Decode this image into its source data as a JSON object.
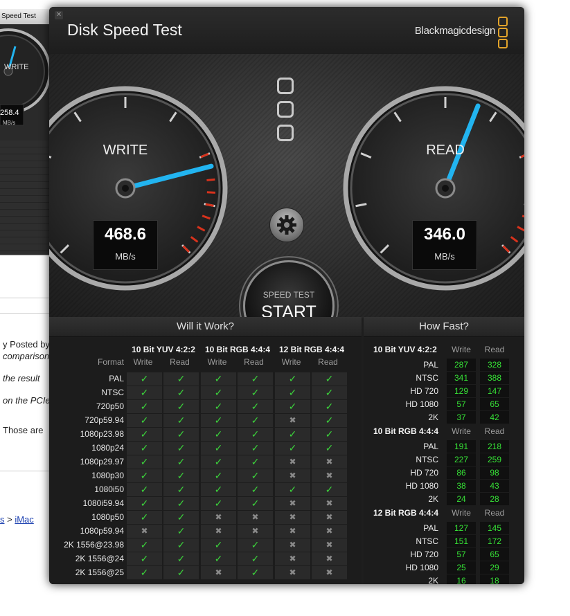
{
  "background_page": {
    "mini_window_title": "Speed Test",
    "mini_gauge_label": "WRITE",
    "mini_gauge_value": "258.4",
    "mini_gauge_unit": "MB/s",
    "text_lines": [
      "y Posted by",
      "comparison",
      "the result",
      "on the PCIe",
      "Those are"
    ],
    "breadcrumb_tail": "s",
    "breadcrumb_sep": ">",
    "breadcrumb_link": "iMac"
  },
  "window": {
    "title": "Disk Speed Test",
    "brand": "Blackmagicdesign"
  },
  "gauges": {
    "write": {
      "label": "WRITE",
      "value": "468.6",
      "unit": "MB/s",
      "needle_fraction": 0.78
    },
    "read": {
      "label": "READ",
      "value": "346.0",
      "unit": "MB/s",
      "needle_fraction": 0.58
    }
  },
  "start_button": {
    "line1": "SPEED TEST",
    "line2": "START"
  },
  "will_it_work": {
    "title": "Will it Work?",
    "format_header": "Format",
    "groups": [
      "10 Bit YUV 4:2:2",
      "10 Bit RGB 4:4:4",
      "12 Bit RGB 4:4:4"
    ],
    "subheaders": [
      "Write",
      "Read",
      "Write",
      "Read",
      "Write",
      "Read"
    ],
    "rows": [
      {
        "format": "PAL",
        "cells": [
          "y",
          "y",
          "y",
          "y",
          "y",
          "y"
        ]
      },
      {
        "format": "NTSC",
        "cells": [
          "y",
          "y",
          "y",
          "y",
          "y",
          "y"
        ]
      },
      {
        "format": "720p50",
        "cells": [
          "y",
          "y",
          "y",
          "y",
          "y",
          "y"
        ]
      },
      {
        "format": "720p59.94",
        "cells": [
          "y",
          "y",
          "y",
          "y",
          "n",
          "y"
        ]
      },
      {
        "format": "1080p23.98",
        "cells": [
          "y",
          "y",
          "y",
          "y",
          "y",
          "y"
        ]
      },
      {
        "format": "1080p24",
        "cells": [
          "y",
          "y",
          "y",
          "y",
          "y",
          "y"
        ]
      },
      {
        "format": "1080p29.97",
        "cells": [
          "y",
          "y",
          "y",
          "y",
          "n",
          "n"
        ]
      },
      {
        "format": "1080p30",
        "cells": [
          "y",
          "y",
          "y",
          "y",
          "n",
          "n"
        ]
      },
      {
        "format": "1080i50",
        "cells": [
          "y",
          "y",
          "y",
          "y",
          "y",
          "y"
        ]
      },
      {
        "format": "1080i59.94",
        "cells": [
          "y",
          "y",
          "y",
          "y",
          "n",
          "n"
        ]
      },
      {
        "format": "1080p50",
        "cells": [
          "y",
          "y",
          "n",
          "n",
          "n",
          "n"
        ]
      },
      {
        "format": "1080p59.94",
        "cells": [
          "n",
          "y",
          "n",
          "n",
          "n",
          "n"
        ]
      },
      {
        "format": "2K 1556@23.98",
        "cells": [
          "y",
          "y",
          "y",
          "y",
          "n",
          "n"
        ]
      },
      {
        "format": "2K 1556@24",
        "cells": [
          "y",
          "y",
          "y",
          "y",
          "n",
          "n"
        ]
      },
      {
        "format": "2K 1556@25",
        "cells": [
          "y",
          "y",
          "n",
          "y",
          "n",
          "n"
        ]
      }
    ],
    "check_glyph": "✓",
    "cross_glyph": "✖"
  },
  "how_fast": {
    "title": "How Fast?",
    "col_write": "Write",
    "col_read": "Read",
    "groups": [
      {
        "name": "10 Bit YUV 4:2:2",
        "rows": [
          {
            "format": "PAL",
            "write": "287",
            "read": "328"
          },
          {
            "format": "NTSC",
            "write": "341",
            "read": "388"
          },
          {
            "format": "HD 720",
            "write": "129",
            "read": "147"
          },
          {
            "format": "HD 1080",
            "write": "57",
            "read": "65"
          },
          {
            "format": "2K",
            "write": "37",
            "read": "42"
          }
        ]
      },
      {
        "name": "10 Bit RGB 4:4:4",
        "rows": [
          {
            "format": "PAL",
            "write": "191",
            "read": "218"
          },
          {
            "format": "NTSC",
            "write": "227",
            "read": "259"
          },
          {
            "format": "HD 720",
            "write": "86",
            "read": "98"
          },
          {
            "format": "HD 1080",
            "write": "38",
            "read": "43"
          },
          {
            "format": "2K",
            "write": "24",
            "read": "28"
          }
        ]
      },
      {
        "name": "12 Bit RGB 4:4:4",
        "rows": [
          {
            "format": "PAL",
            "write": "127",
            "read": "145"
          },
          {
            "format": "NTSC",
            "write": "151",
            "read": "172"
          },
          {
            "format": "HD 720",
            "write": "57",
            "read": "65"
          },
          {
            "format": "HD 1080",
            "write": "25",
            "read": "29"
          },
          {
            "format": "2K",
            "write": "16",
            "read": "18"
          }
        ]
      }
    ]
  },
  "colors": {
    "needle": "#22b4f0",
    "redline": "#d8321c",
    "value_green": "#36e336",
    "check_green": "#3bd13b",
    "logo_orange": "#e2a32a"
  }
}
